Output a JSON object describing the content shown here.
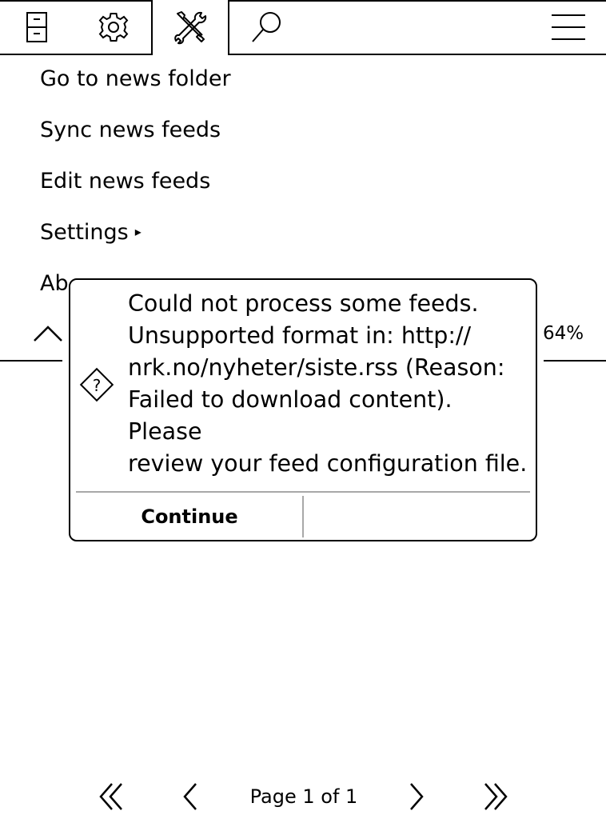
{
  "tabs": [
    {
      "icon": "file-cabinet-icon",
      "active": false
    },
    {
      "icon": "gear-icon",
      "active": false
    },
    {
      "icon": "tools-icon",
      "active": true
    },
    {
      "icon": "search-icon",
      "active": false
    },
    {
      "icon": "hamburger-menu-icon",
      "active": false
    }
  ],
  "menu": {
    "items": [
      {
        "label": "Go to news folder"
      },
      {
        "label": "Sync news feeds"
      },
      {
        "label": "Edit news feeds"
      },
      {
        "label": "Settings",
        "submenu_arrow": "▸"
      },
      {
        "label": "Ab"
      }
    ]
  },
  "frontlight": {
    "percent": "64%",
    "chevron_icon": "chevron-up-icon"
  },
  "dialog": {
    "icon": "question-diamond-icon",
    "message": "Could not process some feeds.\nUnsupported format in:  http://\nnrk.no/nyheter/siste.rss (Reason:\nFailed to download content).\nPlease\nreview your feed configuration file.",
    "button_label": "Continue"
  },
  "footer": {
    "page_label": "Page 1 of 1",
    "icons": [
      "first-page-icon",
      "previous-page-icon",
      "next-page-icon",
      "last-page-icon"
    ]
  }
}
